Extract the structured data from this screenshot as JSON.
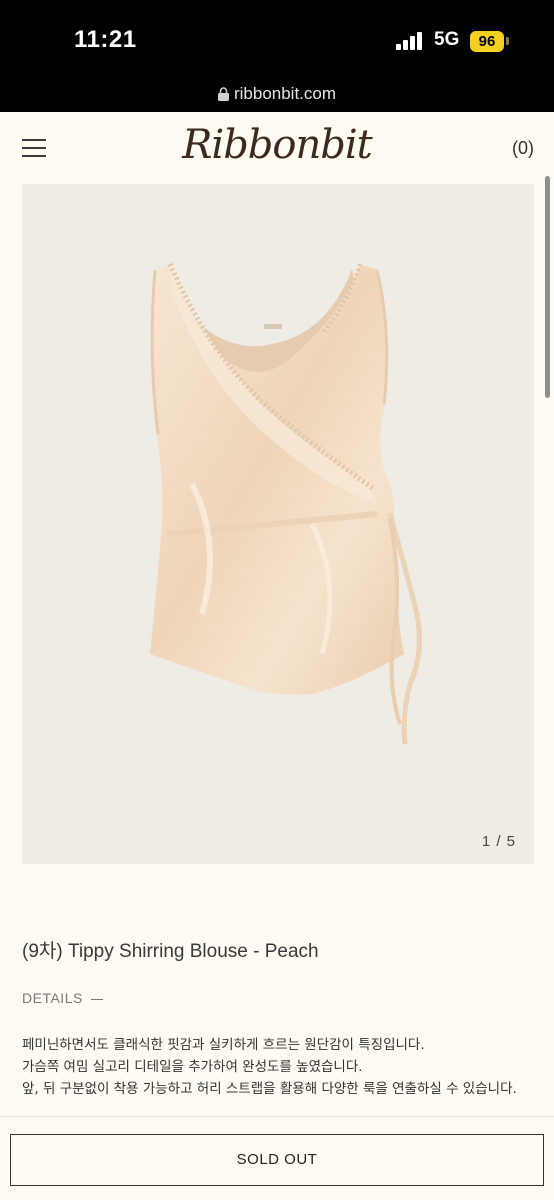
{
  "status_bar": {
    "time": "11:21",
    "network": "5G",
    "battery": "96",
    "battery_color": "#f5d020"
  },
  "browser": {
    "url": "ribbonbit.com",
    "lock_icon": "lock-icon"
  },
  "header": {
    "menu_icon": "hamburger-menu-icon",
    "logo": "Ribbonbit",
    "cart": "(0)"
  },
  "gallery": {
    "counter": "1 / 5",
    "image_desc": "peach satin sleeveless wrap blouse with shirring trim and side tie strap"
  },
  "product": {
    "title": "(9차) Tippy Shirring Blouse - Peach",
    "details_label": "DETAILS",
    "description": [
      "페미닌하면서도 클래식한 핏감과 실키하게 흐르는 원단감이 특징입니다.",
      "가슴쪽 여밈 실고리 디테일을 추가하여 완성도를 높였습니다.",
      "앞, 뒤 구분없이 착용 가능하고 허리 스트랩을 활용해 다양한 룩을 연출하실 수 있습니다."
    ]
  },
  "actions": {
    "sold_out_label": "SOLD OUT"
  },
  "colors": {
    "background": "#fdfbf2",
    "logo": "#3e2a1d",
    "image_bg": "#eeece4",
    "blouse": "#f3dcc2"
  }
}
